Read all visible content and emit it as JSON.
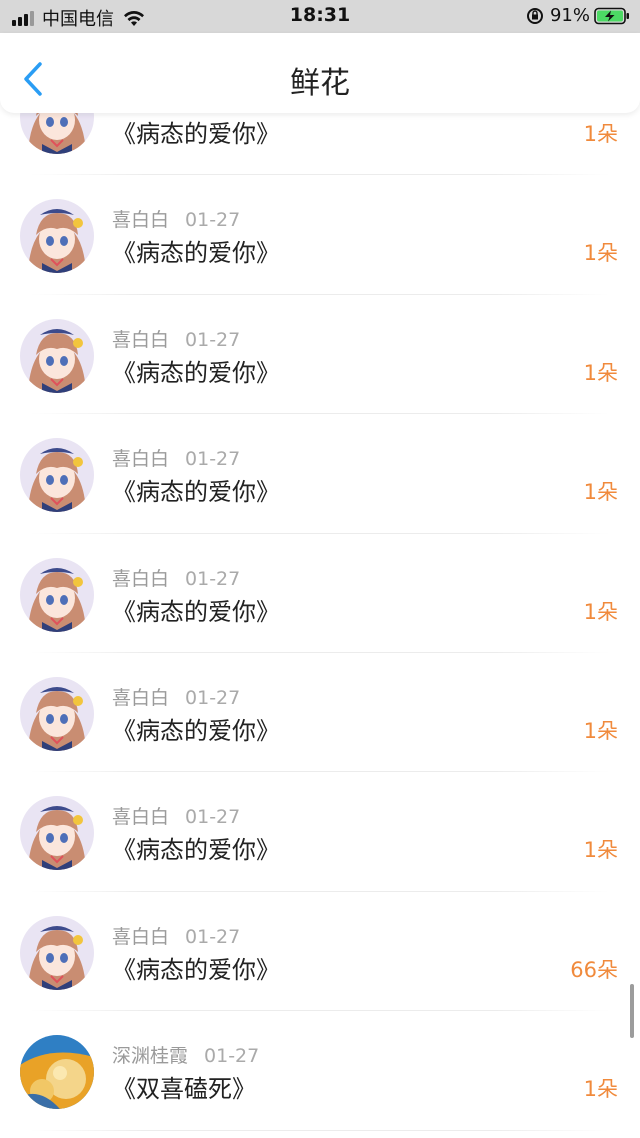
{
  "status_bar": {
    "carrier": "中国电信",
    "time": "18:31",
    "battery": "91%"
  },
  "navbar": {
    "title": "鲜花"
  },
  "colors": {
    "accent_blue": "#2a9df4",
    "flower_count_orange": "#f08a3c"
  },
  "gifts": [
    {
      "user": "",
      "date": "",
      "song": "《病态的爱你》",
      "count": "1朵",
      "avatar": "anime-girl"
    },
    {
      "user": "喜白白",
      "date": "01-27",
      "song": "《病态的爱你》",
      "count": "1朵",
      "avatar": "anime-girl"
    },
    {
      "user": "喜白白",
      "date": "01-27",
      "song": "《病态的爱你》",
      "count": "1朵",
      "avatar": "anime-girl"
    },
    {
      "user": "喜白白",
      "date": "01-27",
      "song": "《病态的爱你》",
      "count": "1朵",
      "avatar": "anime-girl"
    },
    {
      "user": "喜白白",
      "date": "01-27",
      "song": "《病态的爱你》",
      "count": "1朵",
      "avatar": "anime-girl"
    },
    {
      "user": "喜白白",
      "date": "01-27",
      "song": "《病态的爱你》",
      "count": "1朵",
      "avatar": "anime-girl"
    },
    {
      "user": "喜白白",
      "date": "01-27",
      "song": "《病态的爱你》",
      "count": "1朵",
      "avatar": "anime-girl"
    },
    {
      "user": "喜白白",
      "date": "01-27",
      "song": "《病态的爱你》",
      "count": "66朵",
      "avatar": "anime-girl"
    },
    {
      "user": "深渊桂霞",
      "date": "01-27",
      "song": "《双喜磕死》",
      "count": "1朵",
      "avatar": "dessert"
    }
  ]
}
